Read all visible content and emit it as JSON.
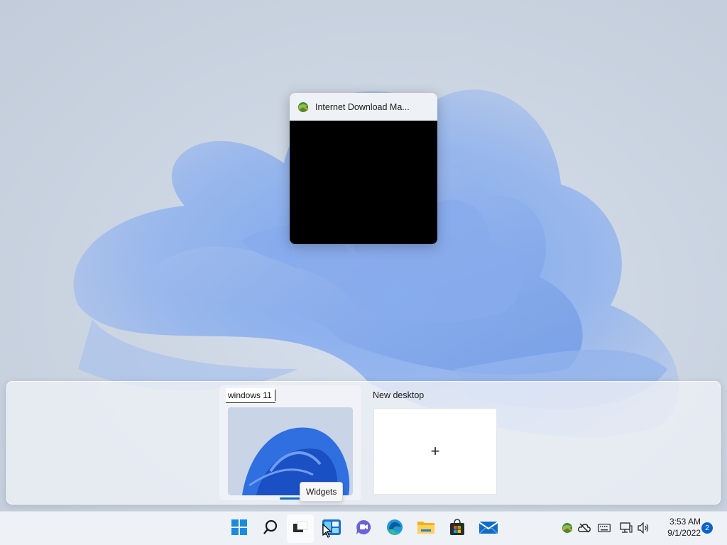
{
  "task_view": {
    "window": {
      "title": "Internet Download Ma...",
      "icon": "idm-globe-icon"
    },
    "desktops": [
      {
        "name": "windows 11",
        "active": true
      },
      {
        "name": "New desktop",
        "add_symbol": "+"
      }
    ]
  },
  "tooltip": {
    "text": "Widgets"
  },
  "taskbar": {
    "apps": [
      {
        "name": "start-button",
        "icon": "windows-logo-icon"
      },
      {
        "name": "search-button",
        "icon": "search-icon"
      },
      {
        "name": "task-view-button",
        "icon": "task-view-icon",
        "active": true
      },
      {
        "name": "widgets-button",
        "icon": "widgets-icon"
      },
      {
        "name": "teams-chat-button",
        "icon": "chat-icon"
      },
      {
        "name": "edge-button",
        "icon": "edge-icon"
      },
      {
        "name": "file-explorer-button",
        "icon": "folder-icon"
      },
      {
        "name": "store-button",
        "icon": "store-icon"
      },
      {
        "name": "mail-button",
        "icon": "mail-icon"
      }
    ],
    "tray": {
      "icons": [
        "idm-globe-icon",
        "onedrive-offline-icon",
        "keyboard-icon",
        "network-icon",
        "volume-icon"
      ],
      "time": "3:53 AM",
      "date": "9/1/2022",
      "notification_count": "2"
    }
  },
  "colors": {
    "accent": "#0a6ccf",
    "bloom": "#4a7fe0",
    "taskbar": "#eef1f5"
  }
}
